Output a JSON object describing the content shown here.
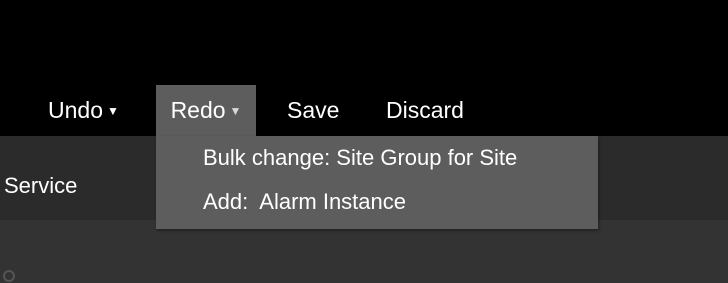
{
  "toolbar": {
    "undo_label": "Undo",
    "undo_arrow": "▼",
    "redo_label": "Redo",
    "redo_arrow": "▼",
    "save_label": "Save",
    "discard_label": "Discard"
  },
  "redo_menu": {
    "items": [
      {
        "label": "Bulk change: Site Group for Site"
      },
      {
        "label": "Add:  Alarm Instance"
      }
    ]
  },
  "content": {
    "column_label": "Service"
  },
  "colors": {
    "background": "#000000",
    "active_button": "#5d5d5d",
    "dropdown": "#5d5d5d",
    "sub_bar": "#2b2b2b",
    "lower_area": "#333333",
    "text": "#ffffff"
  }
}
